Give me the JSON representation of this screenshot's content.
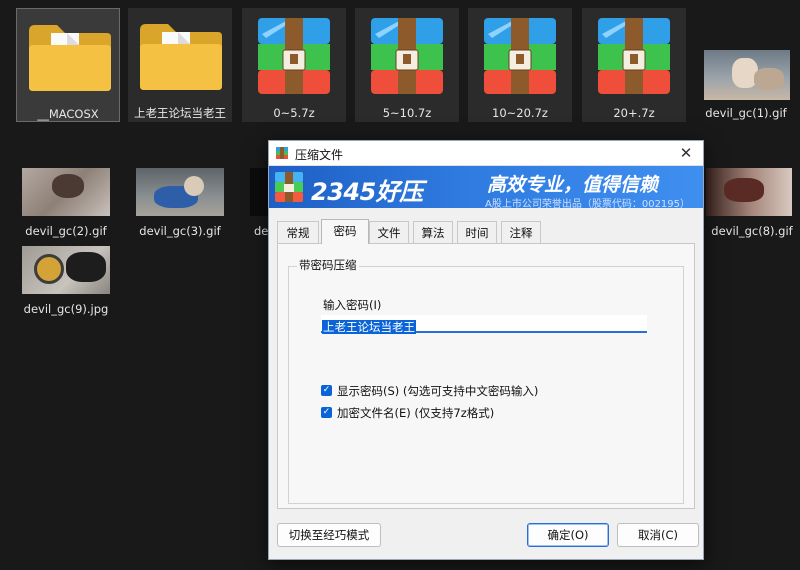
{
  "desktop": {
    "row1": [
      {
        "label": "__MACOSX"
      },
      {
        "label": "上老王论坛当老王"
      },
      {
        "label": "0~5.7z"
      },
      {
        "label": "5~10.7z"
      },
      {
        "label": "10~20.7z"
      },
      {
        "label": "20+.7z"
      },
      {
        "label": "devil_gc(1).gif"
      }
    ],
    "row2": [
      {
        "label": "devil_gc(2).gif"
      },
      {
        "label": "devil_gc(3).gif"
      },
      {
        "label": "de"
      },
      {
        "label": "devil_gc(8).gif"
      }
    ],
    "row3": [
      {
        "label": "devil_gc(9).jpg"
      }
    ]
  },
  "dialog": {
    "title": "压缩文件",
    "banner": {
      "brand": "2345好压",
      "slogan": "高效专业，值得信赖",
      "sub": "A股上市公司荣誉出品（股票代码：002195）"
    },
    "tabs": [
      "常规",
      "密码",
      "文件",
      "算法",
      "时间",
      "注释"
    ],
    "active_tab": "密码",
    "group_title": "带密码压缩",
    "password_label": "输入密码(I)",
    "password_value": "上老王论坛当老王",
    "checkboxes": [
      {
        "label": "显示密码(S)  (勾选可支持中文密码输入)",
        "checked": true
      },
      {
        "label": "加密文件名(E)  (仅支持7z格式)",
        "checked": true
      }
    ],
    "buttons": {
      "switch_mode": "切换至经巧模式",
      "ok": "确定(O)",
      "cancel": "取消(C)"
    }
  },
  "colors": {
    "desktop_bg": "#191919",
    "accent": "#0a64d8",
    "banner": "#2f7be0"
  }
}
